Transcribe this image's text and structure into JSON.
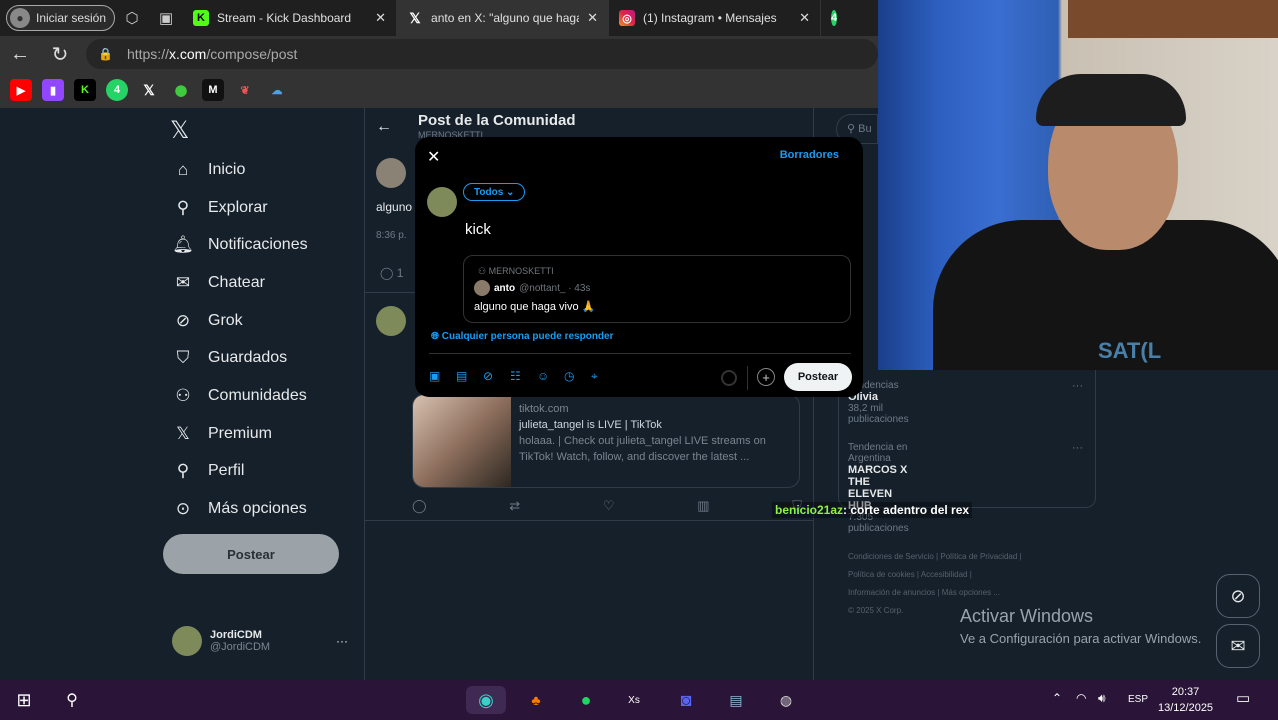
{
  "browser": {
    "signin_label": "Iniciar sesión",
    "tabs": [
      {
        "title": "Stream - Kick Dashboard",
        "icon": "kick-icon",
        "color": "#53fc18"
      },
      {
        "title": "anto en X: \"alguno que haga",
        "icon": "x-icon",
        "color": "#000000"
      },
      {
        "title": "(1) Instagram • Mensajes",
        "icon": "instagram-icon",
        "color": "#e1306c"
      }
    ],
    "extra_tab_badge": "4",
    "url_prefix": "https://",
    "url_host": "x.com",
    "url_path": "/compose/post",
    "bookmarks": [
      "youtube-icon",
      "twitch-icon",
      "kick-icon",
      "whatsapp-icon",
      "x-icon",
      "xbox-icon",
      "mangadex-icon",
      "sauce-icon",
      "cloud-icon"
    ],
    "bookmark_badge": "4"
  },
  "nav": {
    "items": [
      {
        "label": "Inicio",
        "icon": "home-icon"
      },
      {
        "label": "Explorar",
        "icon": "search-icon"
      },
      {
        "label": "Notificaciones",
        "icon": "bell-icon"
      },
      {
        "label": "Chatear",
        "icon": "mail-icon"
      },
      {
        "label": "Grok",
        "icon": "grok-icon"
      },
      {
        "label": "Guardados",
        "icon": "bookmark-icon"
      },
      {
        "label": "Comunidades",
        "icon": "communities-icon"
      },
      {
        "label": "Premium",
        "icon": "x-icon"
      },
      {
        "label": "Perfil",
        "icon": "person-icon"
      },
      {
        "label": "Más opciones",
        "icon": "more-icon"
      }
    ],
    "post_label": "Postear",
    "profile_name": "JordiCDM",
    "profile_handle": "@JordiCDM"
  },
  "main": {
    "title": "Post de la Comunidad",
    "subtitle": "MERNOSKETTI",
    "snippet": "alguno",
    "time": "8:36 p.",
    "reply_count": "1",
    "card": {
      "domain": "tiktok.com",
      "title": "julieta_tangel is LIVE | TikTok",
      "desc": "holaaa. | Check out julieta_tangel LIVE streams on TikTok! Watch, follow, and discover the latest ..."
    }
  },
  "right": {
    "search_placeholder": "Bu",
    "trends": [
      {
        "category": "Tendencias",
        "name": "Olivia",
        "count": "38,2 mil publicaciones"
      },
      {
        "category": "Tendencia en Argentina",
        "name": "MARCOS X THE ELEVEN HUB",
        "count": "7.305 publicaciones"
      }
    ],
    "footer": [
      "Condiciones de Servicio",
      "Política de Privacidad",
      "Política de cookies",
      "Accesibilidad",
      "Información de anuncios",
      "Más opciones ...",
      "© 2025 X Corp."
    ]
  },
  "compose": {
    "drafts_label": "Borradores",
    "audience_label": "Todos",
    "text": "kick",
    "quote": {
      "community": "MERNOSKETTI",
      "author": "anto",
      "handle": "@nottant_",
      "age": "· 43s",
      "body": "alguno que haga vivo 🙏"
    },
    "reply_setting": "Cualquier persona puede responder",
    "post_label": "Postear"
  },
  "overlay": {
    "chat_user": "benicio21az",
    "chat_msg": ": corte adentro del rex",
    "cam_text": "SAT(L"
  },
  "windows": {
    "activate_title": "Activar Windows",
    "activate_sub": "Ve a Configuración para activar Windows.",
    "lang": "ESP",
    "time": "20:37",
    "date": "13/12/2025"
  }
}
